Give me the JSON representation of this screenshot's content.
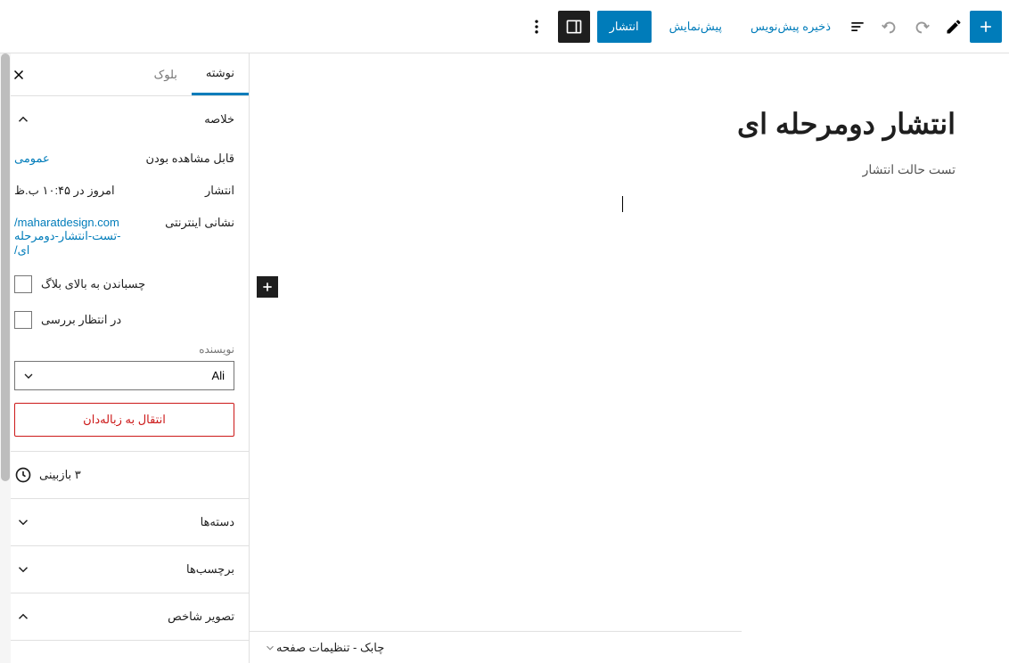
{
  "topbar": {
    "save_draft": "ذخیره پیش‌نویس",
    "preview": "پیش‌نمایش",
    "publish": "انتشار"
  },
  "editor": {
    "title": "انتشار دومرحله ای",
    "paragraph": "تست حالت انتشار"
  },
  "bottom_bar": {
    "label": "چابک - تنظیمات صفحه"
  },
  "sidebar": {
    "tabs": {
      "post": "نوشته",
      "block": "بلوک"
    },
    "summary": {
      "title": "خلاصه",
      "visibility_label": "قابل مشاهده بودن",
      "visibility_value": "عمومی",
      "publish_label": "انتشار",
      "publish_value": "امروز در ۱۰:۴۵ ب.ظ",
      "url_label": "نشانی اینترنتی",
      "url_value": "/maharatdesign.com\nتست-انتشار-دومرحله-\n/ای",
      "stick_label": "چسباندن به بالای بلاگ",
      "pending_label": "در انتظار بررسی",
      "author_label": "نویسنده",
      "author_value": "Ali",
      "trash": "انتقال به زباله‌دان"
    },
    "revisions": "۳ بازبینی",
    "categories": "دسته‌ها",
    "tags": "برچسب‌ها",
    "featured_image": "تصویر شاخص"
  }
}
